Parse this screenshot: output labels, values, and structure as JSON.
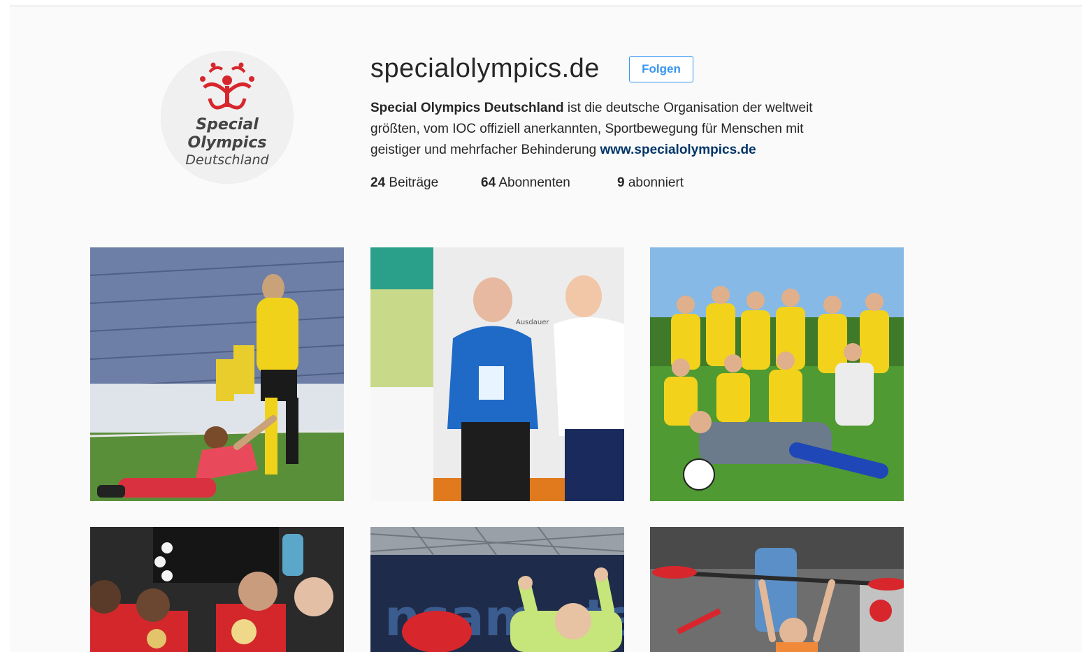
{
  "profile": {
    "username": "specialolympics.de",
    "follow_label": "Folgen",
    "avatar_logo_text": [
      "Special",
      "Olympics",
      "Deutschland"
    ],
    "bio": {
      "name": "Special Olympics Deutschland",
      "text_part1": " ist die deutsche Organisation der weltweit",
      "text_part2": "größten, vom IOC offiziell anerkannten, Sportbewegung für Menschen mit",
      "text_part3": "geistiger und mehrfacher Behinderung ",
      "link": "www.specialolympics.de"
    },
    "stats": {
      "posts_count": "24",
      "posts_label": "Beiträge",
      "followers_count": "64",
      "followers_label": "Abonnenten",
      "following_count": "9",
      "following_label": "abonniert"
    }
  },
  "posts": [
    {
      "name": "post-soccer-handshake",
      "photo_text": ""
    },
    {
      "name": "post-two-people-booth",
      "photo_text": "Ausdauer"
    },
    {
      "name": "post-team-celebration",
      "photo_text": ""
    },
    {
      "name": "post-medal-winners",
      "photo_text": ""
    },
    {
      "name": "post-cheering-stage",
      "photo_text": "nsam sta"
    },
    {
      "name": "post-kayak-paddle",
      "photo_text": ""
    }
  ],
  "colors": {
    "accent": "#3897f0",
    "link": "#003569",
    "logo_red": "#d7262c",
    "page_bg": "#fafafa"
  }
}
